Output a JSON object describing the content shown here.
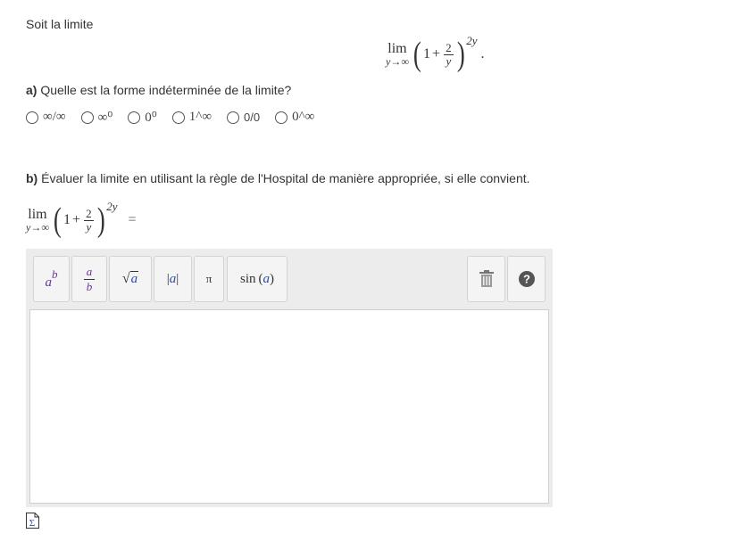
{
  "intro_text": "Soit la limite",
  "formula": {
    "lim": "lim",
    "sub": "y→∞",
    "one": "1",
    "plus": "+",
    "num": "2",
    "den": "y",
    "open_paren": "(",
    "close_paren": ")",
    "exponent": "2y",
    "period": "."
  },
  "part_a": {
    "label": "a)",
    "question": "Quelle est la forme indéterminée de la limite?",
    "choices": [
      "∞/∞",
      "∞⁰",
      "0⁰",
      "1^∞",
      "0/0",
      "0^∞"
    ]
  },
  "part_b": {
    "label": "b)",
    "question": "Évaluer la limite en utilisant la règle de l'Hospital de manière appropriée, si elle convient.",
    "equals": "="
  },
  "toolbar": {
    "power": {
      "base": "a",
      "exp": "b"
    },
    "fraction": {
      "num": "a",
      "den": "b"
    },
    "sqrt": {
      "sign": "√",
      "arg": "a"
    },
    "abs": {
      "bar": "|",
      "arg": "a"
    },
    "pi": "π",
    "sin": {
      "fn": "sin",
      "arg": "a"
    }
  },
  "icons": [
    "trash-icon",
    "help-icon",
    "sigma-icon"
  ],
  "colors": {
    "accent_purple": "#6b2fa0",
    "accent_blue": "#2a4bb0",
    "toolbar_bg": "#ececec"
  }
}
